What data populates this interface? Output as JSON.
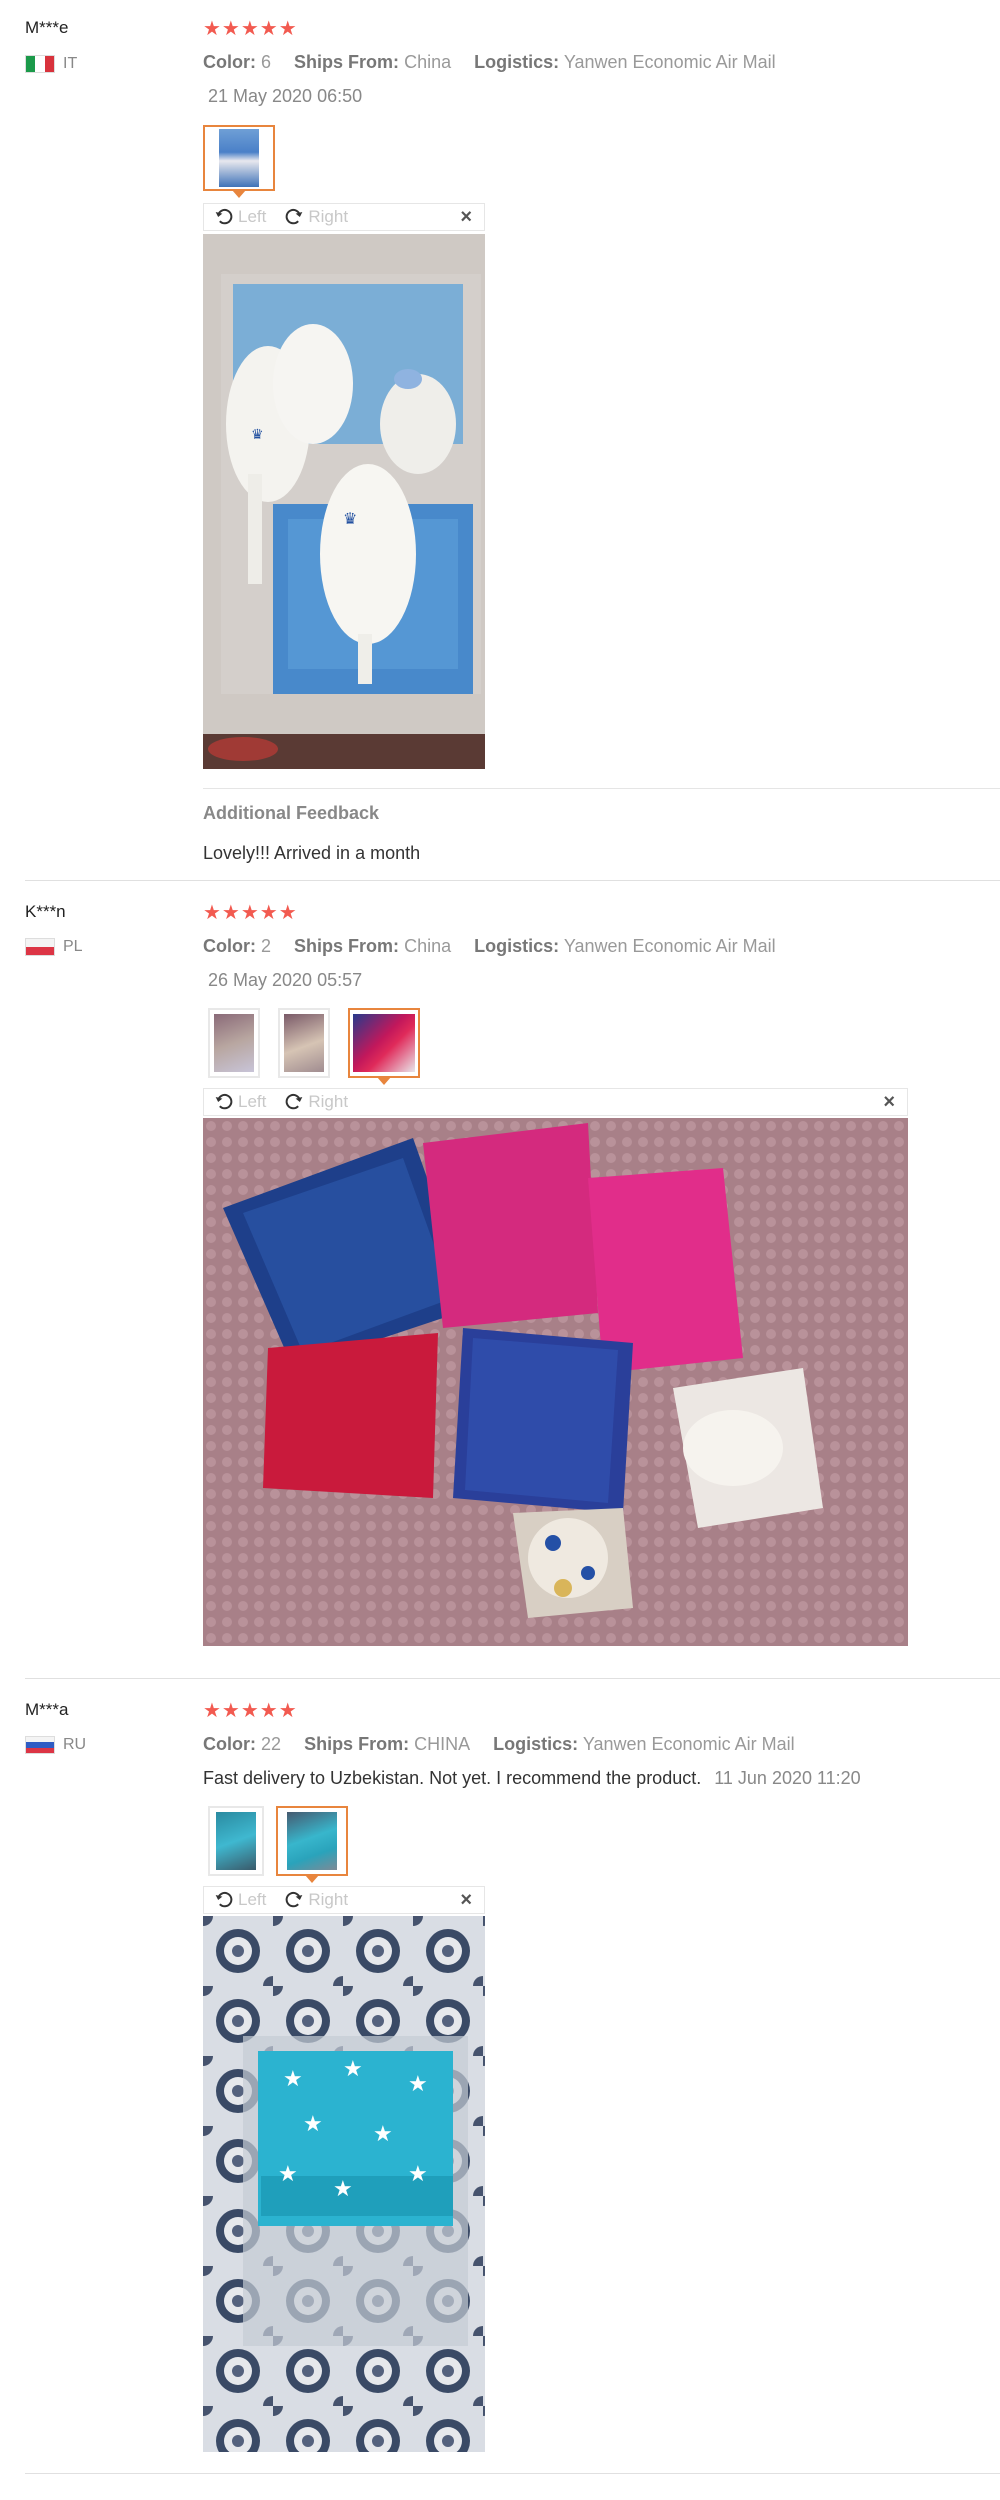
{
  "labels": {
    "color": "Color:",
    "ships_from": "Ships From:",
    "logistics": "Logistics:",
    "rotate_left": "Left",
    "rotate_right": "Right",
    "close": "×",
    "additional_feedback": "Additional Feedback"
  },
  "reviews": [
    {
      "user": "M***e",
      "country": "IT",
      "stars": "★★★★★",
      "rating": 5,
      "color": "6",
      "ships_from": "China",
      "logistics": "Yanwen Economic Air Mail",
      "date": "21 May 2020 06:50",
      "additional_feedback": "Lovely!!! Arrived in a month",
      "photo_count": 1
    },
    {
      "user": "K***n",
      "country": "PL",
      "stars": "★★★★★",
      "rating": 5,
      "color": "2",
      "ships_from": "China",
      "logistics": "Yanwen Economic Air Mail",
      "date": "26 May 2020 05:57",
      "photo_count": 3
    },
    {
      "user": "M***a",
      "country": "RU",
      "stars": "★★★★★",
      "rating": 5,
      "color": "22",
      "ships_from": "CHINA",
      "logistics": "Yanwen Economic Air Mail",
      "review_text": "Fast delivery to Uzbekistan. Not yet. I recommend the product.",
      "date": "11 Jun 2020 11:20",
      "photo_count": 2
    }
  ],
  "colors": {
    "star": "#f25a50",
    "active_thumb_border": "#e8853d",
    "label_text": "#999999"
  }
}
